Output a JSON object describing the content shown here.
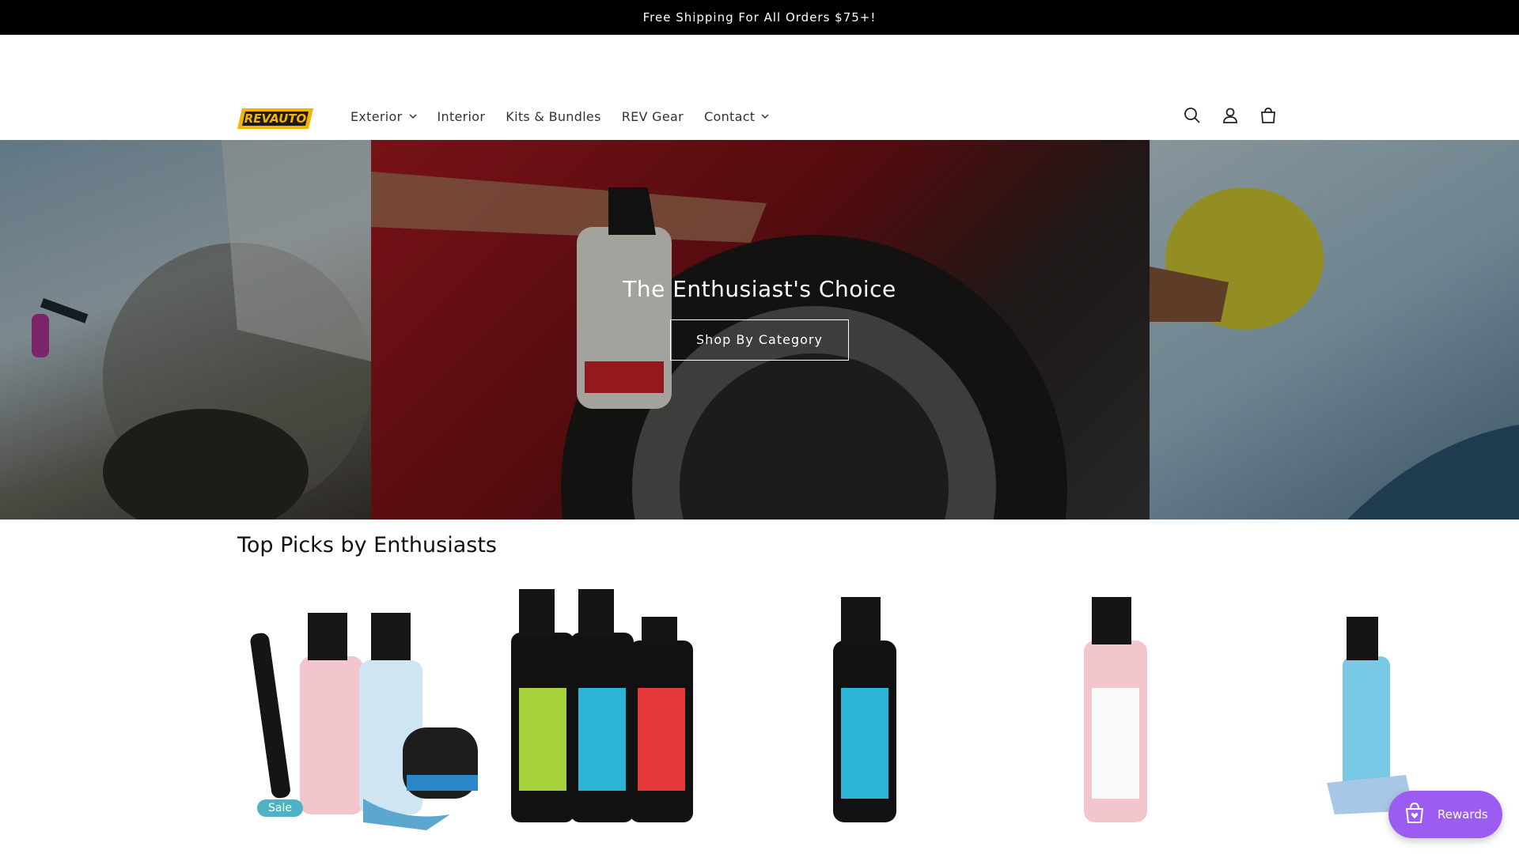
{
  "announcement": "Free Shipping For All Orders $75+!",
  "brand": {
    "logo_text": "REVAUTO"
  },
  "nav": [
    {
      "label": "Exterior",
      "has_dropdown": true
    },
    {
      "label": "Interior",
      "has_dropdown": false
    },
    {
      "label": "Kits & Bundles",
      "has_dropdown": false
    },
    {
      "label": "REV Gear",
      "has_dropdown": false
    },
    {
      "label": "Contact",
      "has_dropdown": true
    }
  ],
  "header_icons": [
    "search-icon",
    "account-icon",
    "cart-icon"
  ],
  "hero": {
    "title": "The Enthusiast's Choice",
    "button_label": "Shop By Category"
  },
  "section_title": "Top Picks by Enthusiasts",
  "products": [
    {
      "badge": ""
    },
    {
      "badge": "Sale"
    },
    {
      "badge": ""
    },
    {
      "badge": ""
    },
    {
      "badge": ""
    }
  ],
  "rewards_label": "Rewards",
  "colors": {
    "accent": "#9c5cf2",
    "sale_badge": "#4db3c4",
    "announcement_bg": "#000000"
  }
}
